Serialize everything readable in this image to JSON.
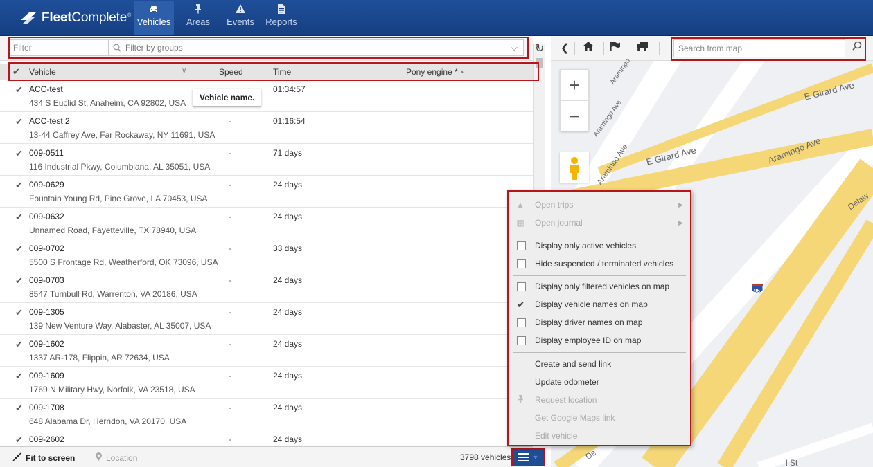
{
  "header": {
    "logo_bold": "Fleet",
    "logo_rest": "Complete",
    "logo_reg": "®",
    "tabs": [
      {
        "label": "Vehicles",
        "icon": "car-icon",
        "active": true
      },
      {
        "label": "Areas",
        "icon": "pin-icon",
        "active": false
      },
      {
        "label": "Events",
        "icon": "warning-icon",
        "active": false
      },
      {
        "label": "Reports",
        "icon": "document-icon",
        "active": false
      }
    ]
  },
  "filter": {
    "placeholder": "Filter",
    "groups_placeholder": "Filter by groups"
  },
  "columns": {
    "vehicle": "Vehicle",
    "speed": "Speed",
    "time": "Time",
    "pony": "Pony engine *"
  },
  "tooltip": "Vehicle name.",
  "vehicles": [
    {
      "name": "ACC-test",
      "address": "434 S Euclid St, Anaheim, CA 92802, USA",
      "speed": "",
      "time": "01:34:57"
    },
    {
      "name": "ACC-test 2",
      "address": "13-44 Caffrey Ave, Far Rockaway, NY 11691, USA",
      "speed": "-",
      "time": "01:16:54"
    },
    {
      "name": "009-0511",
      "address": "116 Industrial Pkwy, Columbiana, AL 35051, USA",
      "speed": "-",
      "time": "71 days"
    },
    {
      "name": "009-0629",
      "address": "Fountain Young Rd, Pine Grove, LA 70453, USA",
      "speed": "-",
      "time": "24 days"
    },
    {
      "name": "009-0632",
      "address": "Unnamed Road, Fayetteville, TX 78940, USA",
      "speed": "-",
      "time": "24 days"
    },
    {
      "name": "009-0702",
      "address": "5500 S Frontage Rd, Weatherford, OK 73096, USA",
      "speed": "-",
      "time": "33 days"
    },
    {
      "name": "009-0703",
      "address": "8547 Turnbull Rd, Warrenton, VA 20186, USA",
      "speed": "-",
      "time": "24 days"
    },
    {
      "name": "009-1305",
      "address": "139 New Venture Way, Alabaster, AL 35007, USA",
      "speed": "-",
      "time": "24 days"
    },
    {
      "name": "009-1602",
      "address": "1337 AR-178, Flippin, AR 72634, USA",
      "speed": "-",
      "time": "24 days"
    },
    {
      "name": "009-1609",
      "address": "1769 N Military Hwy, Norfolk, VA 23518, USA",
      "speed": "-",
      "time": "24 days"
    },
    {
      "name": "009-1708",
      "address": "648 Alabama Dr, Herndon, VA 20170, USA",
      "speed": "-",
      "time": "24 days"
    },
    {
      "name": "009-2602",
      "address": "",
      "speed": "-",
      "time": "24 days"
    }
  ],
  "footer": {
    "fit": "Fit to screen",
    "location": "Location",
    "count": "3798 vehicles"
  },
  "map": {
    "search_placeholder": "Search from map",
    "streets": {
      "aramingo1": "Aramingo Ave",
      "aramingo2": "Aramingo Ave",
      "aramingo3": "Aramingo Ave",
      "aramingo4": "Aramingo",
      "girard1": "E Girard Ave",
      "girard2": "E Girard Ave",
      "delaw": "Delaw",
      "de": "De",
      "st": "l St",
      "shield": "95"
    }
  },
  "menu": {
    "open_trips": "Open trips",
    "open_journal": "Open journal",
    "active_only": "Display only active vehicles",
    "hide_suspended": "Hide suspended / terminated vehicles",
    "filtered_only": "Display only filtered vehicles on map",
    "vehicle_names": "Display vehicle names on map",
    "driver_names": "Display driver names on map",
    "employee_id": "Display employee ID on map",
    "create_link": "Create and send link",
    "update_odometer": "Update odometer",
    "request_location": "Request location",
    "google_link": "Get Google Maps link",
    "edit_vehicle": "Edit vehicle"
  },
  "colors": {
    "header": "#1f4f9a",
    "highlight": "#b5151b",
    "road": "#f7d97a"
  }
}
